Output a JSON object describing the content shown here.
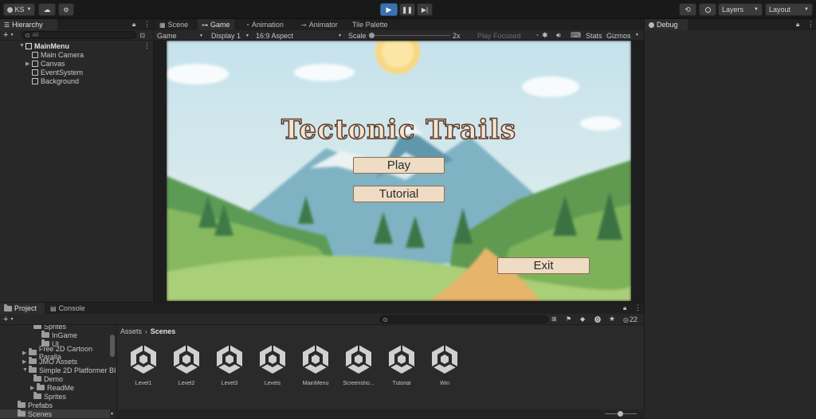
{
  "toolbar": {
    "account": "KS",
    "layers": "Layers",
    "layout": "Layout"
  },
  "hierarchy": {
    "tab": "Hierarchy",
    "search_placeholder": "All",
    "root": "MainMenu",
    "items": [
      "Main Camera",
      "Canvas",
      "EventSystem",
      "Background"
    ]
  },
  "view_tabs": [
    "Scene",
    "Game",
    "Animation",
    "Animator",
    "Tile Palette"
  ],
  "game_toolbar": {
    "mode": "Game",
    "display": "Display 1",
    "aspect": "16:9 Aspect",
    "scale_label": "Scale",
    "scale_value": "2x",
    "play_focused": "Play Focused",
    "stats": "Stats",
    "gizmos": "Gizmos"
  },
  "game": {
    "title": "Tectonic Trails",
    "play": "Play",
    "tutorial": "Tutorial",
    "exit": "Exit"
  },
  "debug": {
    "tab": "Debug"
  },
  "bottom_tabs": [
    "Project",
    "Console"
  ],
  "project": {
    "tree": [
      {
        "label": "Sprites",
        "indent": 2
      },
      {
        "label": "InGame",
        "indent": 3
      },
      {
        "label": "UI",
        "indent": 3
      },
      {
        "label": "Free 2D Cartoon Paralla",
        "indent": 1
      },
      {
        "label": "JMO Assets",
        "indent": 1
      },
      {
        "label": "Simple 2D Platformer BI",
        "indent": 1
      },
      {
        "label": "Demo",
        "indent": 2
      },
      {
        "label": "ReadMe",
        "indent": 2
      },
      {
        "label": "Sprites",
        "indent": 2
      },
      {
        "label": "Prefabs",
        "indent": 0
      },
      {
        "label": "Scenes",
        "indent": 0
      }
    ],
    "breadcrumb_root": "Assets",
    "breadcrumb_current": "Scenes",
    "hidden_count": "22",
    "assets": [
      "Level1",
      "Level2",
      "Level3",
      "Levels",
      "MainMenu",
      "Screensho...",
      "Tutorial",
      "Win"
    ]
  },
  "colors": {
    "editor_bg": "#282828",
    "play_blue": "#3a72b0",
    "button_fill": "#eedcc4",
    "sky": "#cfe6ef"
  }
}
